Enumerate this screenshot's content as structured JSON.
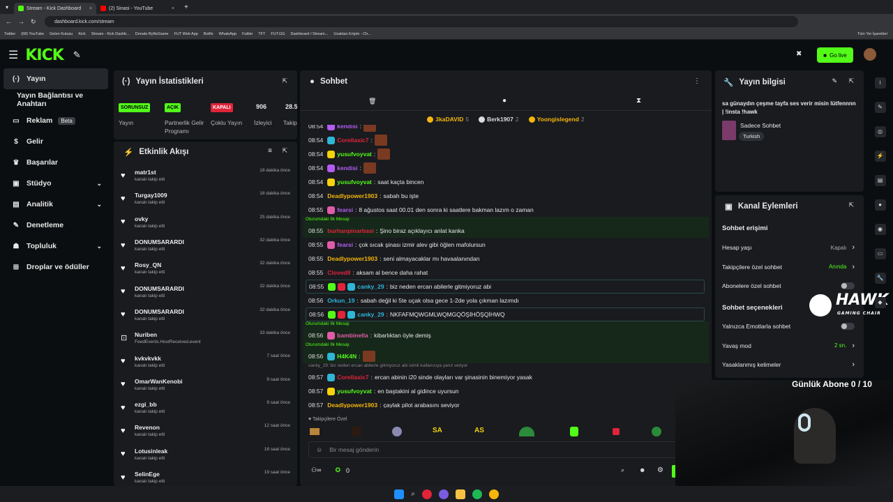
{
  "browser": {
    "tabs": [
      {
        "label": "Stream - Kick Dashboard",
        "color": "#53fc18"
      },
      {
        "label": "(2) Sinasi - YouTube",
        "color": "#ff0000"
      }
    ],
    "url": "dashboard.kick.com/stream",
    "bookmarks": [
      "Twitter",
      "(68) YouTube",
      "Gelen Kutusu",
      "Kick",
      "Stream - Kick Dashb...",
      "Donate ByNoGame",
      "FUT Web App",
      "Botfix",
      "WhatsApp",
      "Futbin",
      "TFT",
      "FUT.GG",
      "Dashboard / Stream...",
      "Uzaktan Erişim - Ch..."
    ],
    "bookmarks_right": "Tüm Yer İşaretleri"
  },
  "header": {
    "logo": "KICK",
    "go_live": "Go live"
  },
  "nav": {
    "items": [
      {
        "label": "Yayın",
        "icon": "live-icon",
        "active": true
      },
      {
        "label": "Yayın Bağlantısı ve Anahtarı",
        "icon": "",
        "active": false
      },
      {
        "label": "Reklam",
        "badge": "Beta",
        "icon": "monitor-icon"
      },
      {
        "label": "Gelir",
        "icon": "dollar-icon"
      },
      {
        "label": "Başarılar",
        "icon": "trophy-icon"
      },
      {
        "label": "Stüdyo",
        "icon": "camera-icon",
        "chevron": true
      },
      {
        "label": "Analitik",
        "icon": "chart-icon",
        "chevron": true
      },
      {
        "label": "Denetleme",
        "icon": "wrench-icon"
      },
      {
        "label": "Topluluk",
        "icon": "users-icon",
        "chevron": true
      },
      {
        "label": "Droplar ve ödüller",
        "icon": "gift-icon"
      }
    ]
  },
  "stats": {
    "title": "Yayın İstatistikleri",
    "cols": [
      {
        "chip": "SORUNSUZ",
        "chip_color": "#53fc18",
        "label": "Yayın"
      },
      {
        "chip": "AÇIK",
        "chip_color": "#53fc18",
        "label": "Partnerlik Gelir Programı"
      },
      {
        "chip": "KAPALI",
        "chip_color": "#e0243a",
        "label": "Çoklu Yayın"
      },
      {
        "chip": "906",
        "chip_color": "",
        "label": "İzleyici"
      },
      {
        "chip": "28.51",
        "chip_color": "",
        "label": "Takip"
      }
    ]
  },
  "activity": {
    "title": "Etkinlik Akışı",
    "items": [
      {
        "name": "matr1st",
        "sub": "kanalı takip etti",
        "time": "18 dakika önce"
      },
      {
        "name": "Turgay1009",
        "sub": "kanalı takip etti",
        "time": "18 dakika önce"
      },
      {
        "name": "ovky",
        "sub": "kanalı takip etti",
        "time": "25 dakika önce"
      },
      {
        "name": "DONUMSARARDI",
        "sub": "kanalı takip etti",
        "time": "32 dakika önce"
      },
      {
        "name": "Rosy_QN",
        "sub": "kanalı takip etti",
        "time": "32 dakika önce"
      },
      {
        "name": "DONUMSARARDI",
        "sub": "kanalı takip etti",
        "time": "32 dakika önce"
      },
      {
        "name": "DONUMSARARDI",
        "sub": "kanalı takip etti",
        "time": "32 dakika önce"
      },
      {
        "name": "Nuriben",
        "sub": "FeedEvents.HostReceived.event",
        "time": "33 dakika önce"
      },
      {
        "name": "kvkvkvkk",
        "sub": "kanalı takip etti",
        "time": "7 saat önce"
      },
      {
        "name": "OmarWanKenobi",
        "sub": "kanalı takip etti",
        "time": "9 saat önce"
      },
      {
        "name": "ezgi_bb",
        "sub": "kanalı takip etti",
        "time": "9 saat önce"
      },
      {
        "name": "Revenon",
        "sub": "kanalı takip etti",
        "time": "12 saat önce"
      },
      {
        "name": "Lotusinleak",
        "sub": "kanalı takip etti",
        "time": "18 saat önce"
      },
      {
        "name": "SelinEge",
        "sub": "kanalı takip etti",
        "time": "19 saat önce"
      }
    ]
  },
  "chat": {
    "title": "Sohbet",
    "leaders": [
      {
        "name": "3kaDAVID",
        "n": "5",
        "color": "#f5b50a"
      },
      {
        "name": "Berk1907",
        "n": "2",
        "color": "#ddd"
      },
      {
        "name": "Yoongislegend",
        "n": "2",
        "color": "#f5b50a"
      }
    ],
    "first_label": "Oturumdaki İlk Mesajı",
    "messages": [
      {
        "t": "08:54",
        "u": "kendisi",
        "c": "#b45cf2",
        "text": "",
        "emote": true,
        "b": "#b45cf2",
        "partial": true
      },
      {
        "t": "08:54",
        "u": "Corellaxic7",
        "c": "#e0243a",
        "text": "",
        "emote": true,
        "b": "#2fb6d6"
      },
      {
        "t": "08:54",
        "u": "yusufvoyvat",
        "c": "#53fc18",
        "text": "",
        "emote": true,
        "b": "#f5d20a"
      },
      {
        "t": "08:54",
        "u": "kendisi",
        "c": "#b45cf2",
        "text": "",
        "emote": true,
        "b": "#b45cf2"
      },
      {
        "t": "08:54",
        "u": "yusufvoyvat",
        "c": "#53fc18",
        "text": "saat kaçta bincen",
        "b": "#f5d20a"
      },
      {
        "t": "08:54",
        "u": "Deadlypower1903",
        "c": "#f5b50a",
        "text": "sabah bu işte"
      },
      {
        "t": "08:55",
        "u": "fearsi",
        "c": "#b45cf2",
        "text": "8 ağustos saat 00.01 den sonra ki saatlere bakman lazım o zaman",
        "b": "#e05ca8"
      },
      {
        "t": "08:55",
        "u": "burhanpinarbasi",
        "c": "#e0243a",
        "text": "Şino biraz açıklayıcı anlat kanka",
        "first": true
      },
      {
        "t": "08:55",
        "u": "fearsi",
        "c": "#b45cf2",
        "text": "çok sıcak şinası izmir alev gibi öğlen mafolursun",
        "b": "#e05ca8"
      },
      {
        "t": "08:55",
        "u": "Deadlypower1903",
        "c": "#f5b50a",
        "text": "seni almayacaklar mı havaalanından"
      },
      {
        "t": "08:55",
        "u": "Cloved8",
        "c": "#e0243a",
        "text": "aksam al bence daha rahat"
      },
      {
        "t": "08:55",
        "u": "canky_29",
        "c": "#2fb6d6",
        "text": "biz neden ercan abilerle gitmiyoruz abi",
        "boxed": true,
        "b": "#53fc18"
      },
      {
        "t": "08:56",
        "u": "Orkun_19",
        "c": "#2fb6d6",
        "text": "sabah değil ki 5te uçak olsa gece 1-2de yola çıkman lazımdı"
      },
      {
        "t": "08:56",
        "u": "canky_29",
        "c": "#2fb6d6",
        "text": "NKFAFMQWGMLWQMGQÖŞİHÖŞQİHWQ",
        "boxed": true,
        "b": "#53fc18"
      },
      {
        "t": "08:56",
        "u": "bambinella",
        "c": "#e05ca8",
        "text": "kibarlıktan öyle demiş",
        "first": true,
        "b": "#e05ca8"
      },
      {
        "t": "08:56",
        "u": "H4K4N",
        "c": "#53fc18",
        "text": "",
        "emote": true,
        "first": true,
        "b": "#2fb6d6"
      },
      {
        "t": "08:57",
        "u": "Corellaxic7",
        "c": "#e0243a",
        "text": "ercan abinin i20 sinde olayları var şinasinin binemiyor yasak",
        "reply": "canky_29: biz neden ercan abilerle gitmiyoruz abi isimli kullanıcıya yanıt veriyor",
        "b": "#2fb6d6"
      },
      {
        "t": "08:57",
        "u": "yusufvoyvat",
        "c": "#53fc18",
        "text": "en baştakini al gidince uyursun",
        "b": "#f5d20a"
      },
      {
        "t": "08:57",
        "u": "Deadlypower1903",
        "c": "#f5b50a",
        "text": "çaylak pilot arabasını seviyor"
      }
    ],
    "followers_only": "Takipçilere Özel",
    "input_placeholder": "Bir mesaj gönderin",
    "points": "0"
  },
  "info": {
    "title": "Yayın bilgisi",
    "stream_title": "sa günaydın çeşme tayfa ses verir misin lütfennnn | !insta !hawk",
    "category": "Sadece Sohbet",
    "language": "Turkish"
  },
  "actions": {
    "title": "Kanal Eylemleri",
    "access_title": "Sohbet erişimi",
    "rows": [
      {
        "label": "Hesap yaşı",
        "value": "Kapalı",
        "value_color": "#aaa",
        "type": "chevron"
      },
      {
        "label": "Takipçilere özel sohbet",
        "value": "Anında",
        "value_color": "#53fc18",
        "type": "chevron"
      },
      {
        "label": "Abonelere özel sohbet",
        "type": "toggle"
      }
    ],
    "options_title": "Sohbet seçenekleri",
    "rows2": [
      {
        "label": "Yalnızca Emotlarla sohbet",
        "type": "toggle"
      },
      {
        "label": "Yavaş mod",
        "value": "2 sn.",
        "value_color": "#53fc18",
        "type": "chevron"
      },
      {
        "label": "Yasaklanmış kelimeler",
        "type": "chevron"
      }
    ]
  },
  "overlay": {
    "subs": "Günlük Abone 0 / 10",
    "hawk": "HAWK",
    "hawk_sub": "GAMING CHAIR"
  }
}
